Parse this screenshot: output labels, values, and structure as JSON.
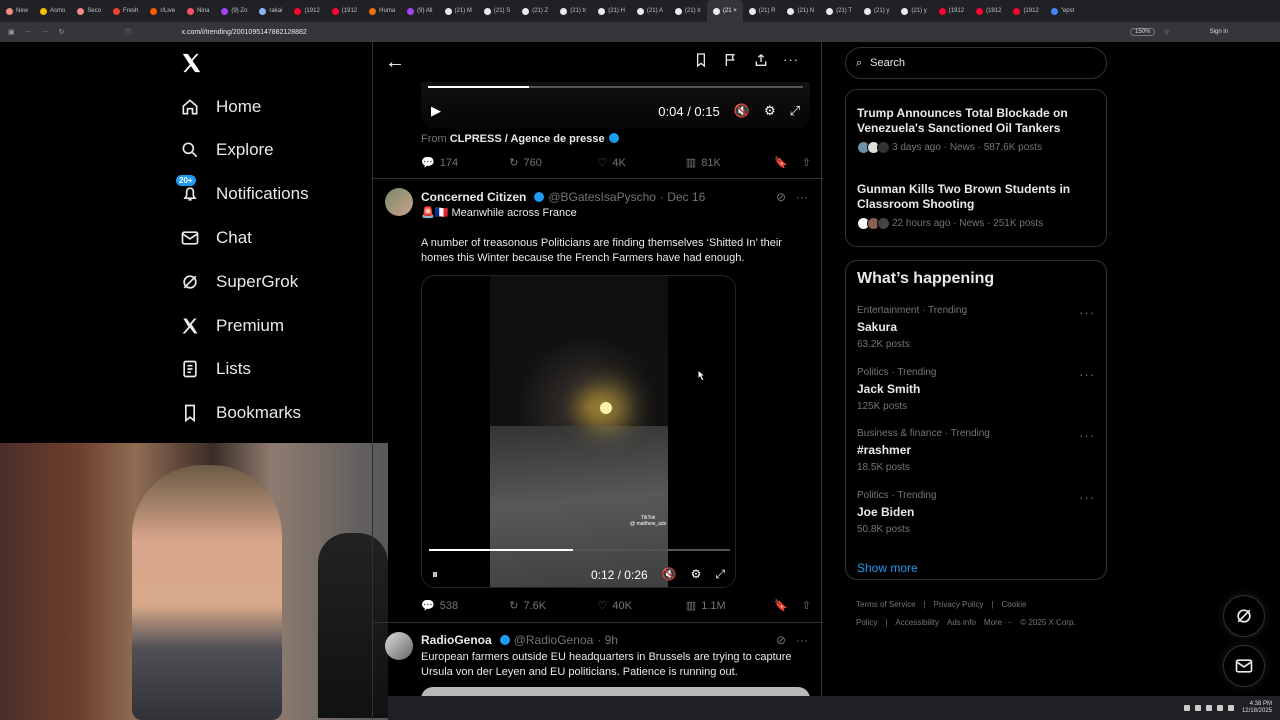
{
  "browser": {
    "tabs": [
      {
        "label": "New",
        "color": "#f28b82"
      },
      {
        "label": "Asmo",
        "color": "#fbbc04"
      },
      {
        "label": "Seco",
        "color": "#f28b82"
      },
      {
        "label": "Fresh",
        "color": "#ea4335"
      },
      {
        "label": "r/Live",
        "color": "#ff5700"
      },
      {
        "label": "Nina",
        "color": "#ff4f70"
      },
      {
        "label": "(9) Zo",
        "color": "#a142f4"
      },
      {
        "label": "rakai",
        "color": "#8ab4f8"
      },
      {
        "label": "(1912",
        "color": "#ff0033"
      },
      {
        "label": "(1912",
        "color": "#ff0033"
      },
      {
        "label": "Huma",
        "color": "#e8710a"
      },
      {
        "label": "(9) All",
        "color": "#a142f4"
      },
      {
        "label": "(21) M",
        "color": "#e8eaed"
      },
      {
        "label": "(21) S",
        "color": "#e8eaed"
      },
      {
        "label": "(21) Z",
        "color": "#e8eaed"
      },
      {
        "label": "(21) tr",
        "color": "#e8eaed"
      },
      {
        "label": "(21) H",
        "color": "#e8eaed"
      },
      {
        "label": "(21) A",
        "color": "#e8eaed"
      },
      {
        "label": "(21) Ir",
        "color": "#e8eaed"
      },
      {
        "label": "(21 ×",
        "color": "#e8eaed"
      },
      {
        "label": "(21) R",
        "color": "#e8eaed"
      },
      {
        "label": "(21) N",
        "color": "#e8eaed"
      },
      {
        "label": "(21) T",
        "color": "#e8eaed"
      },
      {
        "label": "(21) y",
        "color": "#e8eaed"
      },
      {
        "label": "(21) y",
        "color": "#e8eaed"
      },
      {
        "label": "(1912",
        "color": "#ff0033"
      },
      {
        "label": "(1912",
        "color": "#ff0033"
      },
      {
        "label": "(1912",
        "color": "#ff0033"
      },
      {
        "label": "\"epst",
        "color": "#4285f4"
      }
    ],
    "url": "x.com/i/trending/2001095147882128882",
    "zoom": "150%",
    "signin": "Sign in"
  },
  "sidebar": {
    "items": [
      {
        "label": "Home"
      },
      {
        "label": "Explore"
      },
      {
        "label": "Notifications",
        "badge": "20+"
      },
      {
        "label": "Chat"
      },
      {
        "label": "SuperGrok"
      },
      {
        "label": "Premium"
      },
      {
        "label": "Lists"
      },
      {
        "label": "Bookmarks"
      }
    ]
  },
  "main": {
    "video1": {
      "time": "0:04 / 0:15",
      "progress": 0.27
    },
    "from_prefix": "From",
    "from_source": "CLPRESS / Agence de presse",
    "tweet1_stats": {
      "replies": "174",
      "reposts": "760",
      "likes": "4K",
      "views": "81K"
    },
    "tweet2": {
      "name": "Concerned Citizen",
      "handle": "@BGatesIsaPyscho",
      "date": "· Dec 16",
      "line1": "🚨🇫🇷 Meanwhile across France",
      "body": "A number of treasonous Politicians are finding themselves ‘Shitted In’ their homes this Winter because the French Farmers have had enough.",
      "video_time": "0:12 / 0:26",
      "progress": 0.48,
      "tiktok_label": "TikTok",
      "tiktok_handle": "@ matthew_ads",
      "stats": {
        "replies": "538",
        "reposts": "7.6K",
        "likes": "40K",
        "views": "1.1M"
      }
    },
    "tweet3": {
      "name": "RadioGenoa",
      "handle": "@RadioGenoa",
      "date": "· 9h",
      "body": "European farmers outside EU headquarters in Brussels are trying to capture Ursula von der Leyen and EU politicians. Patience is running out."
    }
  },
  "right": {
    "search_placeholder": "Search",
    "news": [
      {
        "title": "Trump Announces Total Blockade on Venezuela's Sanctioned Oil Tankers",
        "meta": "3 days ago · News · 587.6K posts"
      },
      {
        "title": "Gunman Kills Two Brown Students in Classroom Shooting",
        "meta": "22 hours ago · News · 251K posts"
      }
    ],
    "happening_title": "What’s happening",
    "trends": [
      {
        "category": "Entertainment · Trending",
        "name": "Sakura",
        "count": "63.2K posts"
      },
      {
        "category": "Politics · Trending",
        "name": "Jack Smith",
        "count": "125K posts"
      },
      {
        "category": "Business & finance · Trending",
        "name": "#rashmer",
        "count": "18.5K posts"
      },
      {
        "category": "Politics · Trending",
        "name": "Joe Biden",
        "count": "50.8K posts"
      }
    ],
    "show_more": "Show more",
    "footer": [
      "Terms of Service",
      "|",
      "Privacy Policy",
      "|",
      "Cookie Policy",
      "|",
      "Accessibility",
      "Ads info",
      "More ···",
      "© 2025 X Corp."
    ]
  },
  "taskbar": {
    "time": "4:38 PM",
    "date": "12/18/2025"
  },
  "colors": {
    "accent": "#1d9bf0",
    "background": "#000000",
    "border": "#2f3336"
  }
}
